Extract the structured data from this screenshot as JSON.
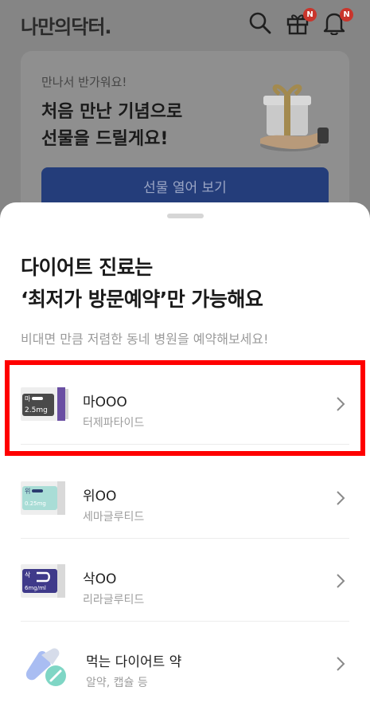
{
  "header": {
    "logo": "나만의닥터.",
    "gift_badge": "N",
    "bell_badge": "N"
  },
  "promo": {
    "subtitle": "만나서 반가워요!",
    "title_line1": "처음 만난 기념으로",
    "title_line2": "선물을 드릴게요!",
    "button": "선물 열어 보기"
  },
  "sheet": {
    "title_line1": "다이어트 진료는",
    "title_line2": "‘최저가 방문예약’만 가능해요",
    "subtitle": "비대면 만큼 저렴한 동네 병원을 예약해보세요!",
    "items": [
      {
        "name": "마OOO",
        "desc": "터제파타이드",
        "pen_label": "마",
        "dose": "2.5mg",
        "color": "#5a3f93"
      },
      {
        "name": "위OO",
        "desc": "세마글루티드",
        "pen_label": "위",
        "dose": "0.25mg",
        "color": "#3aa39a"
      },
      {
        "name": "삭OO",
        "desc": "리라글루티드",
        "pen_label": "삭",
        "dose": "6mg/ml",
        "color": "#3f3a8a"
      },
      {
        "name": "먹는 다이어트 약",
        "desc": "알약, 캡슐 등",
        "icon": "pill-icon"
      }
    ]
  },
  "colors": {
    "highlight": "#ff0000",
    "primary_button": "#243d7a"
  }
}
